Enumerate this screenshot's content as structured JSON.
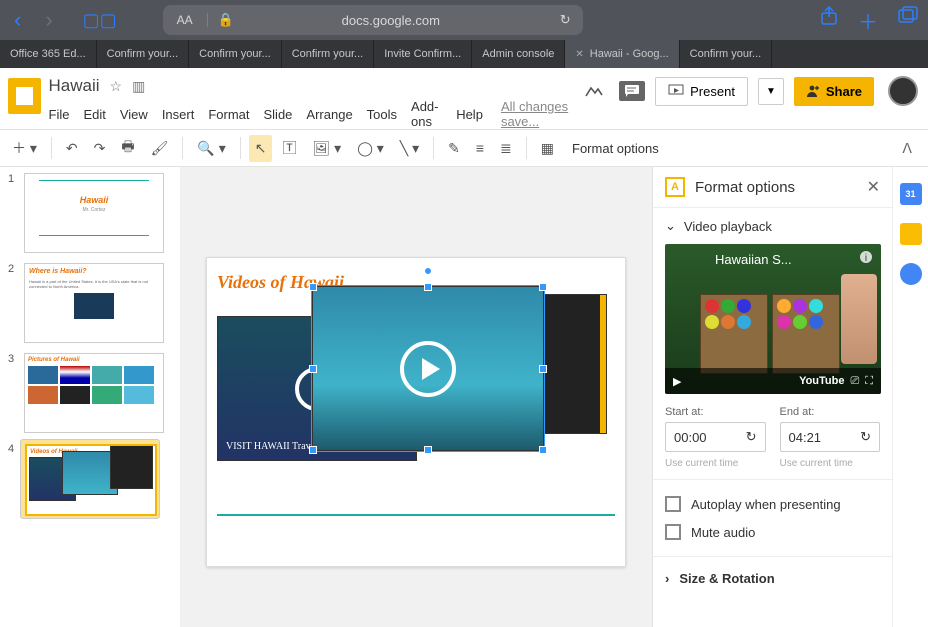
{
  "browser": {
    "url_host": "docs.google.com",
    "aa_label": "AA",
    "tabs": [
      {
        "label": "Office 365 Ed..."
      },
      {
        "label": "Confirm your..."
      },
      {
        "label": "Confirm your..."
      },
      {
        "label": "Confirm your..."
      },
      {
        "label": "Invite Confirm..."
      },
      {
        "label": "Admin console"
      },
      {
        "label": "Hawaii - Goog...",
        "active": true,
        "closable": true
      },
      {
        "label": "Confirm your..."
      }
    ]
  },
  "app": {
    "doc_title": "Hawaii",
    "menus": [
      "File",
      "Edit",
      "View",
      "Insert",
      "Format",
      "Slide",
      "Arrange",
      "Tools",
      "Add-ons",
      "Help"
    ],
    "save_status": "All changes save...",
    "present_label": "Present",
    "share_label": "Share"
  },
  "toolbar": {
    "format_options_btn": "Format options"
  },
  "thumbnails": [
    {
      "num": "1",
      "title": "Hawaii",
      "subtitle": "Mr. Cortez"
    },
    {
      "num": "2",
      "title": "Where is Hawaii?"
    },
    {
      "num": "3",
      "title": "Pictures of Hawaii"
    },
    {
      "num": "4",
      "title": "Videos of Hawaii",
      "selected": true
    }
  ],
  "slide": {
    "title": "Videos of Hawaii"
  },
  "format_panel": {
    "title": "Format options",
    "section_video": "Video playback",
    "preview_title": "Hawaiian S...",
    "youtube_label": "YouTube",
    "start_label": "Start at:",
    "start_value": "00:00",
    "end_label": "End at:",
    "end_value": "04:21",
    "use_current": "Use current time",
    "autoplay_label": "Autoplay when presenting",
    "mute_label": "Mute audio",
    "size_rotation": "Size & Rotation"
  },
  "rightrail": {
    "calendar_day": "31"
  }
}
